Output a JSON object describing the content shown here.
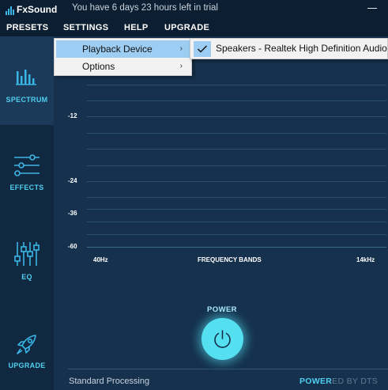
{
  "app": {
    "logo_text": "FxSound",
    "trial_message": "You have 6 days 23 hours left in trial"
  },
  "menu": {
    "items": [
      "PRESETS",
      "SETTINGS",
      "HELP",
      "UPGRADE"
    ]
  },
  "settings_dropdown": {
    "items": [
      {
        "label": "Playback Device",
        "highlighted": true
      },
      {
        "label": "Options",
        "highlighted": false
      }
    ],
    "playback_submenu": {
      "selected_device": "Speakers - Realtek High Definition Audio",
      "checked": true
    }
  },
  "sidebar": {
    "tabs": [
      {
        "label": "SPECTRUM",
        "icon": "spectrum-icon",
        "active": true
      },
      {
        "label": "EFFECTS",
        "icon": "sliders-icon",
        "active": false
      },
      {
        "label": "EQ",
        "icon": "eq-icon",
        "active": false
      },
      {
        "label": "UPGRADE",
        "icon": "rocket-icon",
        "active": false
      }
    ]
  },
  "chart_data": {
    "type": "spectrum",
    "title": "",
    "xlabel": "FREQUENCY BANDS",
    "x_tick_labels": [
      "40Hz",
      "14kHz"
    ],
    "y_tick_labels": [
      "-12",
      "-24",
      "-36",
      "-60"
    ],
    "values": [],
    "grid": true
  },
  "power": {
    "label": "POWER",
    "state": "on"
  },
  "footer": {
    "status": "Standard Processing",
    "brand_bright": "POWER",
    "brand_faint": "ED BY DTS"
  },
  "colors": {
    "accent": "#55e0f2",
    "background": "#15314d",
    "menu_highlight": "#9dcdf2"
  }
}
